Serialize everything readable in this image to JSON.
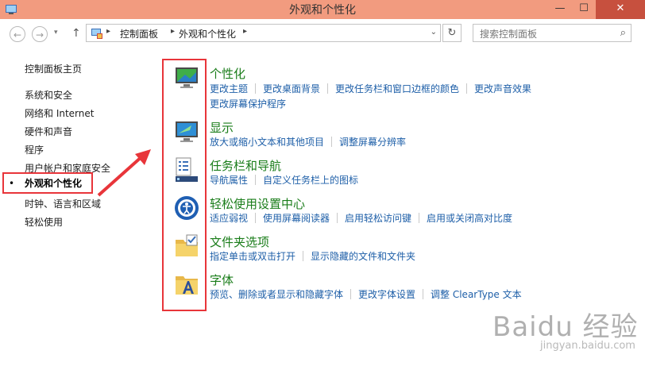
{
  "window": {
    "title": "外观和个性化",
    "min": "—",
    "max": "☐",
    "close": "✕"
  },
  "nav": {
    "back": "←",
    "forward": "→",
    "dropdown": "▾",
    "up": "↑",
    "breadcrumb": [
      "控制面板",
      "外观和个性化"
    ],
    "sep": "▸",
    "address_dropdown": "⌄",
    "refresh": "↻",
    "search_placeholder": "搜索控制面板",
    "search_icon": "⌕"
  },
  "sidebar": {
    "home": "控制面板主页",
    "items": [
      "系统和安全",
      "网络和 Internet",
      "硬件和声音",
      "程序",
      "用户帐户和家庭安全"
    ],
    "current": "外观和个性化",
    "items_after": [
      "时钟、语言和区域",
      "轻松使用"
    ],
    "bullet": "•"
  },
  "categories": [
    {
      "title": "个性化",
      "icon": "personalization-icon",
      "rows": [
        [
          "更改主题",
          "更改桌面背景",
          "更改任务栏和窗口边框的颜色",
          "更改声音效果"
        ],
        [
          "更改屏幕保护程序"
        ]
      ]
    },
    {
      "title": "显示",
      "icon": "display-icon",
      "rows": [
        [
          "放大或缩小文本和其他项目",
          "调整屏幕分辨率"
        ]
      ]
    },
    {
      "title": "任务栏和导航",
      "icon": "taskbar-icon",
      "rows": [
        [
          "导航属性",
          "自定义任务栏上的图标"
        ]
      ]
    },
    {
      "title": "轻松使用设置中心",
      "icon": "ease-of-access-icon",
      "rows": [
        [
          "适应弱视",
          "使用屏幕阅读器",
          "启用轻松访问键",
          "启用或关闭高对比度"
        ]
      ]
    },
    {
      "title": "文件夹选项",
      "icon": "folder-options-icon",
      "rows": [
        [
          "指定单击或双击打开",
          "显示隐藏的文件和文件夹"
        ]
      ]
    },
    {
      "title": "字体",
      "icon": "fonts-icon",
      "rows": [
        [
          "预览、删除或者显示和隐藏字体",
          "更改字体设置",
          "调整 ClearType 文本"
        ]
      ]
    }
  ],
  "watermark": {
    "brand": "Baidu 经验",
    "url": "jingyan.baidu.com"
  },
  "colors": {
    "title_bar": "#f29b7f",
    "highlight": "#e8353a",
    "category_title": "#1a7d1a",
    "link": "#1e5fa8"
  }
}
